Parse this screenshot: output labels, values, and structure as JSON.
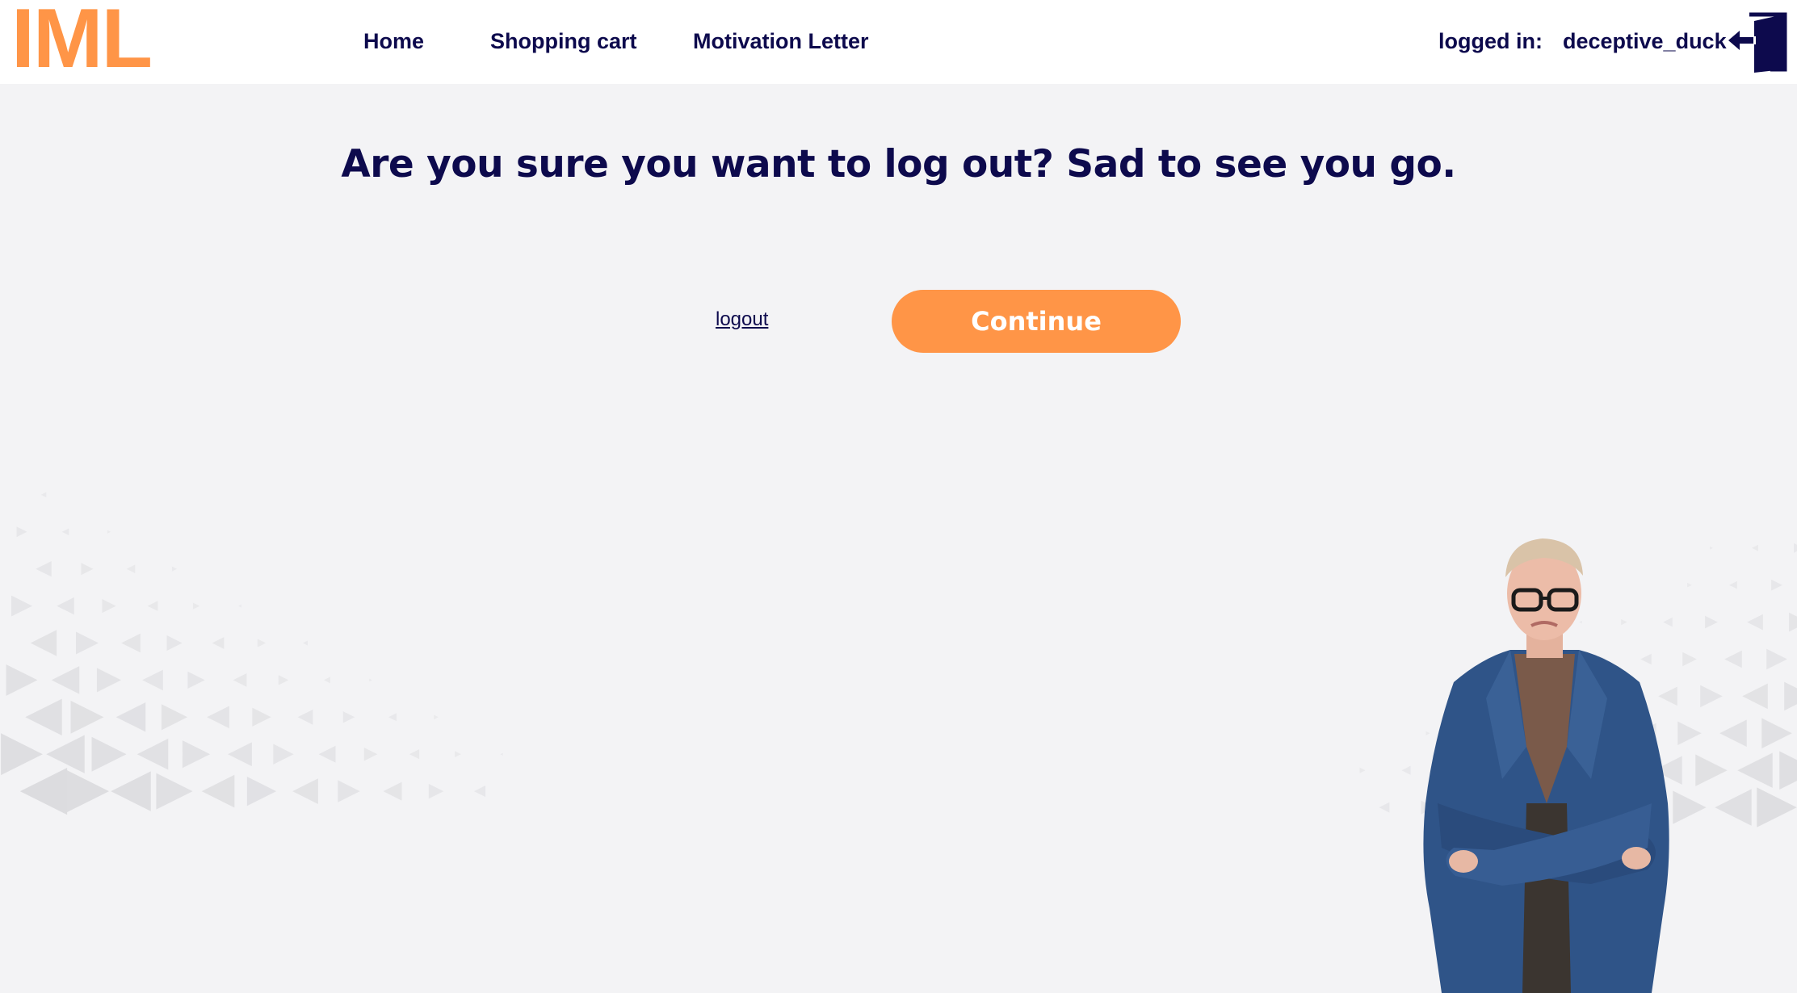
{
  "header": {
    "logo_text": "IML",
    "nav": [
      {
        "label": "Home"
      },
      {
        "label": "Shopping cart"
      },
      {
        "label": "Motivation Letter"
      }
    ],
    "logged_in_label": "logged in:",
    "username": "deceptive_duck",
    "logout_icon": "logout-door-icon"
  },
  "main": {
    "headline": "Are you sure you want to log out? Sad to see you go.",
    "logout_link": "logout",
    "continue_button": "Continue"
  },
  "colors": {
    "accent": "#ff9547",
    "text": "#0d0a4d",
    "background": "#f3f3f5",
    "header_bg": "#ffffff"
  }
}
